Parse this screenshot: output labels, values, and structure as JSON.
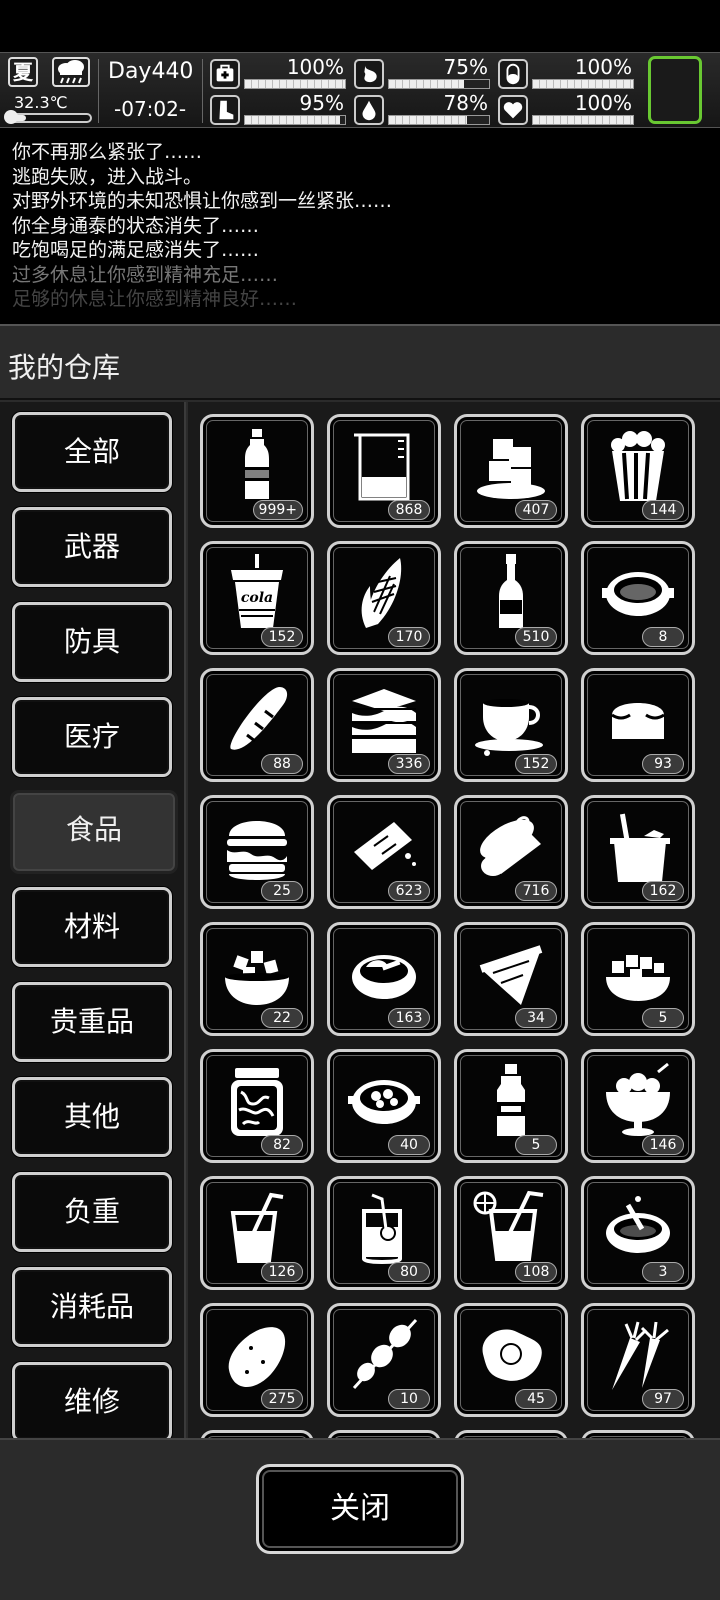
{
  "status": {
    "season": "夏",
    "temperature": "32.3℃",
    "thermometer_level": 0.22,
    "day": "Day440",
    "time": "-07:02-",
    "stats": [
      {
        "icon": "medkit-icon",
        "value": "100%",
        "level": 1.0
      },
      {
        "icon": "stomach-icon",
        "value": "75%",
        "level": 0.75
      },
      {
        "icon": "capsule-icon",
        "value": "100%",
        "level": 1.0
      },
      {
        "icon": "boot-icon",
        "value": "95%",
        "level": 0.95
      },
      {
        "icon": "water-drop-icon",
        "value": "78%",
        "level": 0.78
      },
      {
        "icon": "heart-icon",
        "value": "100%",
        "level": 1.0
      }
    ],
    "accent_color": "#69c832"
  },
  "log": [
    "你不再那么紧张了……",
    "逃跑失败，进入战斗。",
    "对野外环境的未知恐惧让你感到一丝紧张……",
    "你全身通泰的状态消失了……",
    "吃饱喝足的满足感消失了……",
    "过多休息让你感到精神充足……",
    "足够的休息让你感到精神良好……"
  ],
  "panel": {
    "title": "我的仓库",
    "close_label": "关闭"
  },
  "categories": [
    {
      "label": "全部",
      "active": false
    },
    {
      "label": "武器",
      "active": false
    },
    {
      "label": "防具",
      "active": false
    },
    {
      "label": "医疗",
      "active": false
    },
    {
      "label": "食品",
      "active": true
    },
    {
      "label": "材料",
      "active": false
    },
    {
      "label": "贵重品",
      "active": false
    },
    {
      "label": "其他",
      "active": false
    },
    {
      "label": "负重",
      "active": false
    },
    {
      "label": "消耗品",
      "active": false
    },
    {
      "label": "维修",
      "active": false
    }
  ],
  "items": [
    {
      "icon": "water-bottle-icon",
      "count": "999+"
    },
    {
      "icon": "beaker-icon",
      "count": "868"
    },
    {
      "icon": "ice-cubes-icon",
      "count": "407"
    },
    {
      "icon": "popcorn-icon",
      "count": "144"
    },
    {
      "icon": "cola-cup-icon",
      "count": "152",
      "label": "cola"
    },
    {
      "icon": "corn-icon",
      "count": "170"
    },
    {
      "icon": "liquor-bottle-icon",
      "count": "510"
    },
    {
      "icon": "soup-bowl-icon",
      "count": "8"
    },
    {
      "icon": "baguette-icon",
      "count": "88"
    },
    {
      "icon": "sandwich-icon",
      "count": "336"
    },
    {
      "icon": "coffee-cup-icon",
      "count": "152"
    },
    {
      "icon": "bread-loaf-icon",
      "count": "93"
    },
    {
      "icon": "burger-icon",
      "count": "25"
    },
    {
      "icon": "chocolate-bar-icon",
      "count": "623"
    },
    {
      "icon": "canned-food-icon",
      "count": "716"
    },
    {
      "icon": "ice-bucket-icon",
      "count": "162"
    },
    {
      "icon": "salad-bowl-icon",
      "count": "22"
    },
    {
      "icon": "meat-bowl-icon",
      "count": "163"
    },
    {
      "icon": "pizza-slice-icon",
      "count": "34"
    },
    {
      "icon": "tofu-bowl-icon",
      "count": "5"
    },
    {
      "icon": "pickle-jar-icon",
      "count": "82"
    },
    {
      "icon": "stew-pot-icon",
      "count": "40"
    },
    {
      "icon": "sauce-bottle-icon",
      "count": "5"
    },
    {
      "icon": "sundae-icon",
      "count": "146"
    },
    {
      "icon": "juice-glass-icon",
      "count": "126"
    },
    {
      "icon": "lemonade-icon",
      "count": "80"
    },
    {
      "icon": "citrus-drink-icon",
      "count": "108"
    },
    {
      "icon": "porridge-bowl-icon",
      "count": "3"
    },
    {
      "icon": "potato-icon",
      "count": "275"
    },
    {
      "icon": "skewer-icon",
      "count": "10"
    },
    {
      "icon": "fried-egg-icon",
      "count": "45"
    },
    {
      "icon": "carrot-icon",
      "count": "97"
    }
  ]
}
